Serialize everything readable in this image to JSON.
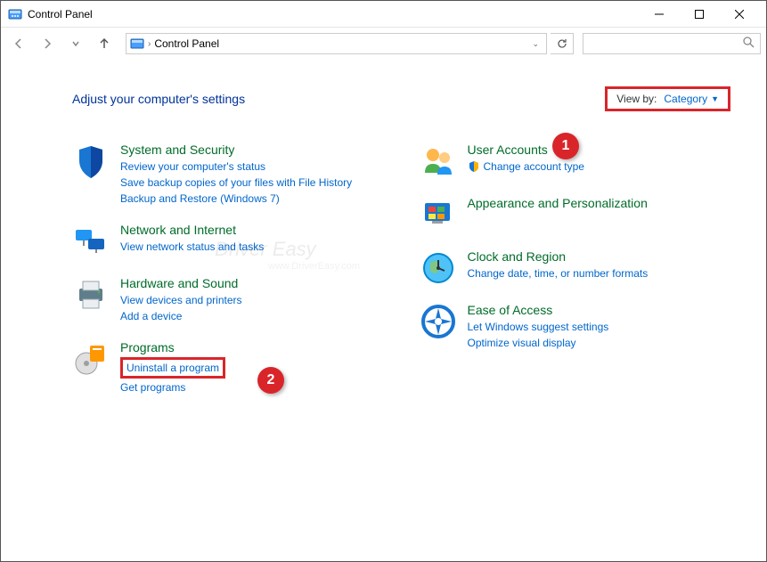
{
  "window": {
    "title": "Control Panel"
  },
  "breadcrumb": {
    "text": "Control Panel"
  },
  "header": {
    "title": "Adjust your computer's settings",
    "viewby_label": "View by:",
    "viewby_value": "Category"
  },
  "left": {
    "system": {
      "title": "System and Security",
      "l1": "Review your computer's status",
      "l2": "Save backup copies of your files with File History",
      "l3": "Backup and Restore (Windows 7)"
    },
    "network": {
      "title": "Network and Internet",
      "l1": "View network status and tasks"
    },
    "hardware": {
      "title": "Hardware and Sound",
      "l1": "View devices and printers",
      "l2": "Add a device"
    },
    "programs": {
      "title": "Programs",
      "l1": "Uninstall a program",
      "l2": "Get programs"
    }
  },
  "right": {
    "users": {
      "title": "User Accounts",
      "l1": "Change account type"
    },
    "appearance": {
      "title": "Appearance and Personalization"
    },
    "clock": {
      "title": "Clock and Region",
      "l1": "Change date, time, or number formats"
    },
    "ease": {
      "title": "Ease of Access",
      "l1": "Let Windows suggest settings",
      "l2": "Optimize visual display"
    }
  },
  "callouts": {
    "c1": "1",
    "c2": "2"
  },
  "watermark": {
    "main": "Driver Easy",
    "sub": "www.DriverEasy.com"
  }
}
